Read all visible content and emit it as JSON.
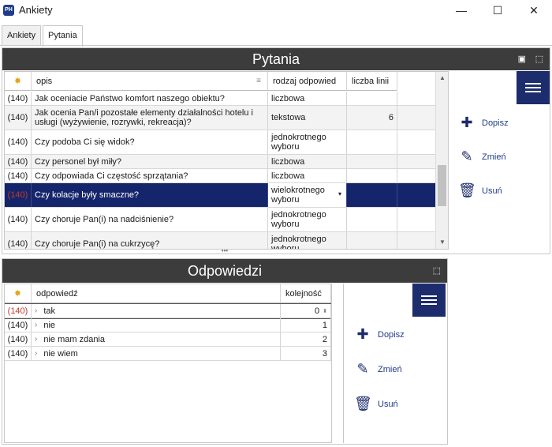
{
  "window": {
    "icon_text": "PH",
    "title": "Ankiety",
    "minimize": "—",
    "maximize": "☐",
    "close": "✕"
  },
  "tabs": [
    {
      "label": "Ankiety",
      "active": false
    },
    {
      "label": "Pytania",
      "active": true
    }
  ],
  "questions_panel": {
    "title": "Pytania",
    "columns": {
      "star": "✸",
      "opis": "opis",
      "rodzaj": "rodzaj odpowied",
      "liczba": "liczba linii"
    },
    "rows": [
      {
        "id": "(140)",
        "opis": "Jak oceniacie Państwo komfort naszego obiektu?",
        "rodzaj": "liczbowa",
        "liczba": ""
      },
      {
        "id": "(140)",
        "opis": "Jak ocenia Pan/i pozostałe elementy działalności hotelu i usługi (wyżywienie, rozrywki, rekreacja)?",
        "rodzaj": "tekstowa",
        "liczba": "6"
      },
      {
        "id": "(140)",
        "opis": "Czy podoba Ci się widok?",
        "rodzaj": "jednokrotnego wyboru",
        "liczba": ""
      },
      {
        "id": "(140)",
        "opis": "Czy personel był miły?",
        "rodzaj": "liczbowa",
        "liczba": ""
      },
      {
        "id": "(140)",
        "opis": "Czy odpowiada Ci częstość sprzątania?",
        "rodzaj": "liczbowa",
        "liczba": ""
      },
      {
        "id": "(140)",
        "opis": "Czy kolacje były smaczne?",
        "rodzaj": "wielokrotnego wyboru",
        "liczba": ""
      },
      {
        "id": "(140)",
        "opis": "Czy choruje Pan(i) na nadciśnienie?",
        "rodzaj": "jednokrotnego wyboru",
        "liczba": ""
      },
      {
        "id": "(140)",
        "opis": "Czy choruje Pan(i) na cukrzycę?",
        "rodzaj": "jednokrotnego wyboru",
        "liczba": ""
      }
    ],
    "actions": {
      "add": "Dopisz",
      "edit": "Zmień",
      "delete": "Usuń"
    }
  },
  "answers_panel": {
    "title": "Odpowiedzi",
    "columns": {
      "star": "✸",
      "odpowiedz": "odpowiedź",
      "kolejnosc": "kolejność"
    },
    "rows": [
      {
        "id": "(140)",
        "odpowiedz": "tak",
        "kolejnosc": "0"
      },
      {
        "id": "(140)",
        "odpowiedz": "nie",
        "kolejnosc": "1"
      },
      {
        "id": "(140)",
        "odpowiedz": "nie mam zdania",
        "kolejnosc": "2"
      },
      {
        "id": "(140)",
        "odpowiedz": "nie wiem",
        "kolejnosc": "3"
      }
    ],
    "actions": {
      "add": "Dopisz",
      "edit": "Zmień",
      "delete": "Usuń"
    }
  },
  "splitter": "•••",
  "colors": {
    "header_bg": "#3c3c3c",
    "selection": "#15256b",
    "accent": "#1c2c6c",
    "id_red": "#c0392b"
  }
}
